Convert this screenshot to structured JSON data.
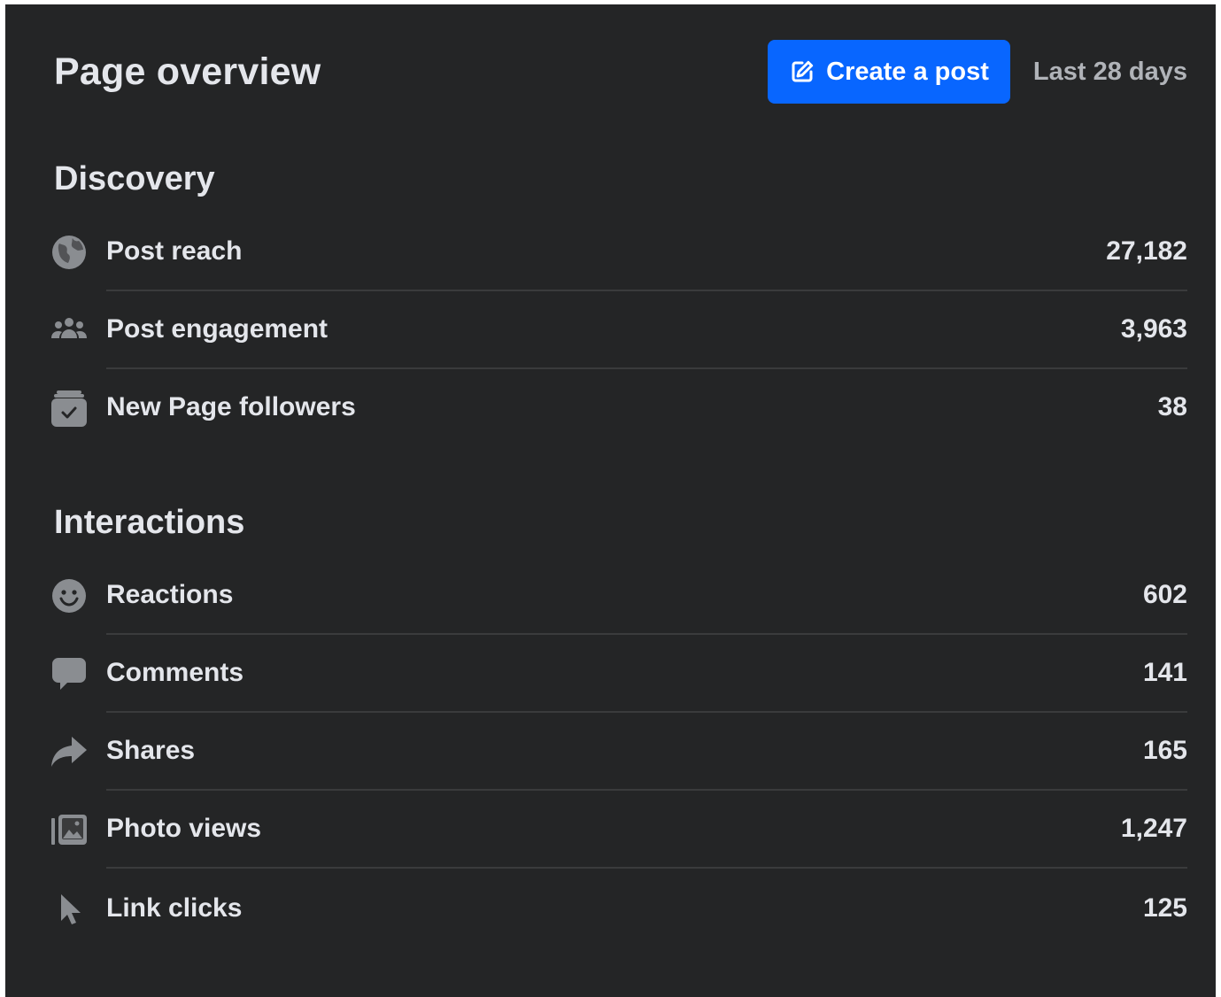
{
  "header": {
    "title": "Page overview",
    "create_post_label": "Create a post",
    "create_post_icon": "edit-icon",
    "date_range": "Last 28 days",
    "accent_color": "#0866ff"
  },
  "discovery": {
    "title": "Discovery",
    "metrics": [
      {
        "label": "Post reach",
        "value": "27,182",
        "icon": "globe-icon"
      },
      {
        "label": "Post engagement",
        "value": "3,963",
        "icon": "people-icon"
      },
      {
        "label": "New Page followers",
        "value": "38",
        "icon": "follow-check-icon"
      }
    ]
  },
  "interactions": {
    "title": "Interactions",
    "metrics": [
      {
        "label": "Reactions",
        "value": "602",
        "icon": "smiley-icon"
      },
      {
        "label": "Comments",
        "value": "141",
        "icon": "comment-bubble-icon"
      },
      {
        "label": "Shares",
        "value": "165",
        "icon": "share-arrow-icon"
      },
      {
        "label": "Photo views",
        "value": "1,247",
        "icon": "photo-icon"
      },
      {
        "label": "Link clicks",
        "value": "125",
        "icon": "cursor-icon"
      }
    ]
  }
}
